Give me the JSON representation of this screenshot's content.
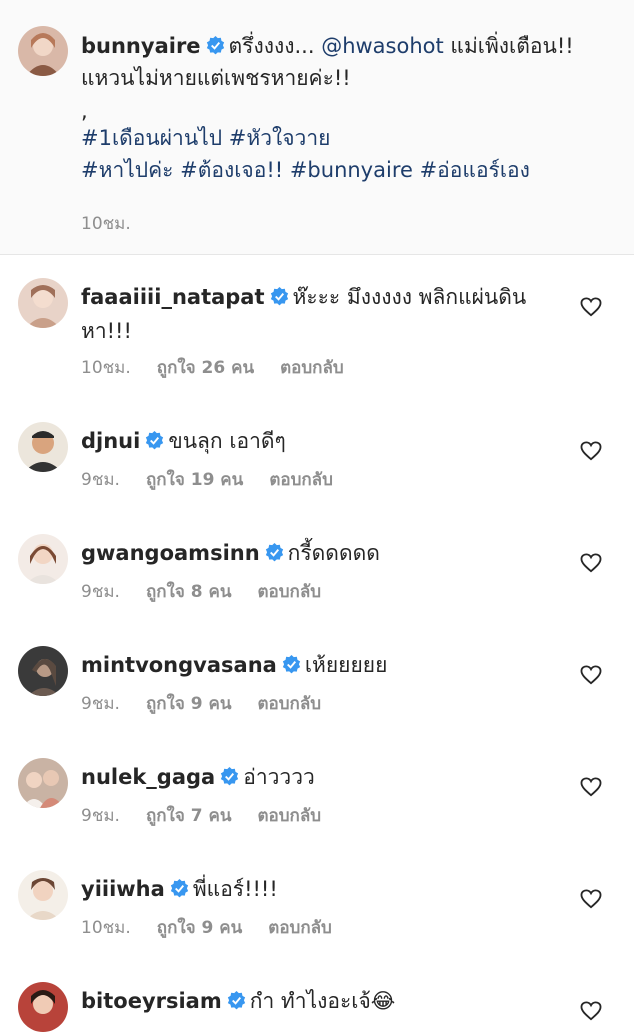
{
  "caption": {
    "username": "bunnyaire",
    "text_line1": "ตรึ่งงงง... ",
    "mention": "@hwasohot",
    "text_line1_end": " แม่เพิ่งเตือน!!",
    "text_line2": "แหวนไม่หายแต่เพชรหายค่ะ!!",
    "text_line3": ",",
    "hashtags_line1": "#1เดือนผ่านไป #หัวใจวาย",
    "hashtags_line2": "#หาไปค่ะ #ต้องเจอ!! #bunnyaire #อ่อแอร์เอง",
    "time": "10ชม."
  },
  "comments": [
    {
      "username": "faaaiiii_natapat",
      "text": "ห๊ะะะ มึงงงงง พลิกแผ่นดิน",
      "text2": "หา!!!",
      "time": "10ชม.",
      "likes": "ถูกใจ 26 คน",
      "reply": "ตอบกลับ"
    },
    {
      "username": "djnui",
      "text": "ขนลุก เอาดีๆ",
      "time": "9ชม.",
      "likes": "ถูกใจ 19 คน",
      "reply": "ตอบกลับ"
    },
    {
      "username": "gwangoamsinn",
      "text": "กรี้ดดดดด",
      "time": "9ชม.",
      "likes": "ถูกใจ 8 คน",
      "reply": "ตอบกลับ"
    },
    {
      "username": "mintvongvasana",
      "text": "เห้ยยยยย",
      "time": "9ชม.",
      "likes": "ถูกใจ 9 คน",
      "reply": "ตอบกลับ"
    },
    {
      "username": "nulek_gaga",
      "text": "อ่าวววว",
      "time": "9ชม.",
      "likes": "ถูกใจ 7 คน",
      "reply": "ตอบกลับ"
    },
    {
      "username": "yiiiwha",
      "text": "พี่แอร์!!!!",
      "time": "10ชม.",
      "likes": "ถูกใจ 9 คน",
      "reply": "ตอบกลับ"
    },
    {
      "username": "bitoeyrsiam",
      "text": "กำ ทำไงอะเจ้",
      "emoji": "😂"
    }
  ],
  "colors": {
    "verified": "#3897f0",
    "link": "#1e3d6b",
    "meta": "#8e8e8e",
    "caption_bg": "#fafafa"
  }
}
